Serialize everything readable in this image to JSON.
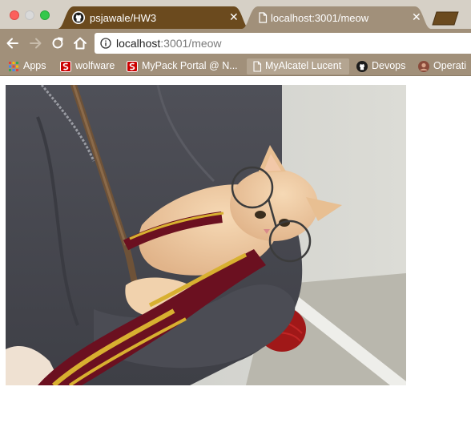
{
  "window": {
    "controls": [
      "close",
      "minimize",
      "zoom"
    ]
  },
  "tabs": [
    {
      "title": "psjawale/HW3",
      "favicon": "github-icon",
      "active": false
    },
    {
      "title": "localhost:3001/meow",
      "favicon": "page-icon",
      "active": true
    }
  ],
  "toolbar": {
    "back": "arrow-left-icon",
    "forward": "arrow-right-icon",
    "reload": "reload-icon",
    "home": "home-icon",
    "url_host": "localhost",
    "url_rest": ":3001/meow"
  },
  "bookmarks": [
    {
      "label": "Apps",
      "icon": "apps-grid-icon"
    },
    {
      "label": "wolfware",
      "icon": "ncstate-icon"
    },
    {
      "label": "MyPack Portal @ N...",
      "icon": "ncstate-icon"
    },
    {
      "label": "MyAlcatel Lucent",
      "icon": "page-icon"
    },
    {
      "label": "Devops",
      "icon": "github-icon"
    },
    {
      "label": "Operati",
      "icon": "avatar-icon"
    }
  ],
  "content": {
    "image_alt": "cat"
  },
  "colors": {
    "tab_active": "#a1907a",
    "tab_inactive": "#6b4a1e",
    "toolbar": "#a1907a",
    "close_button": "#fc605c",
    "zoom_button": "#34c84a"
  }
}
